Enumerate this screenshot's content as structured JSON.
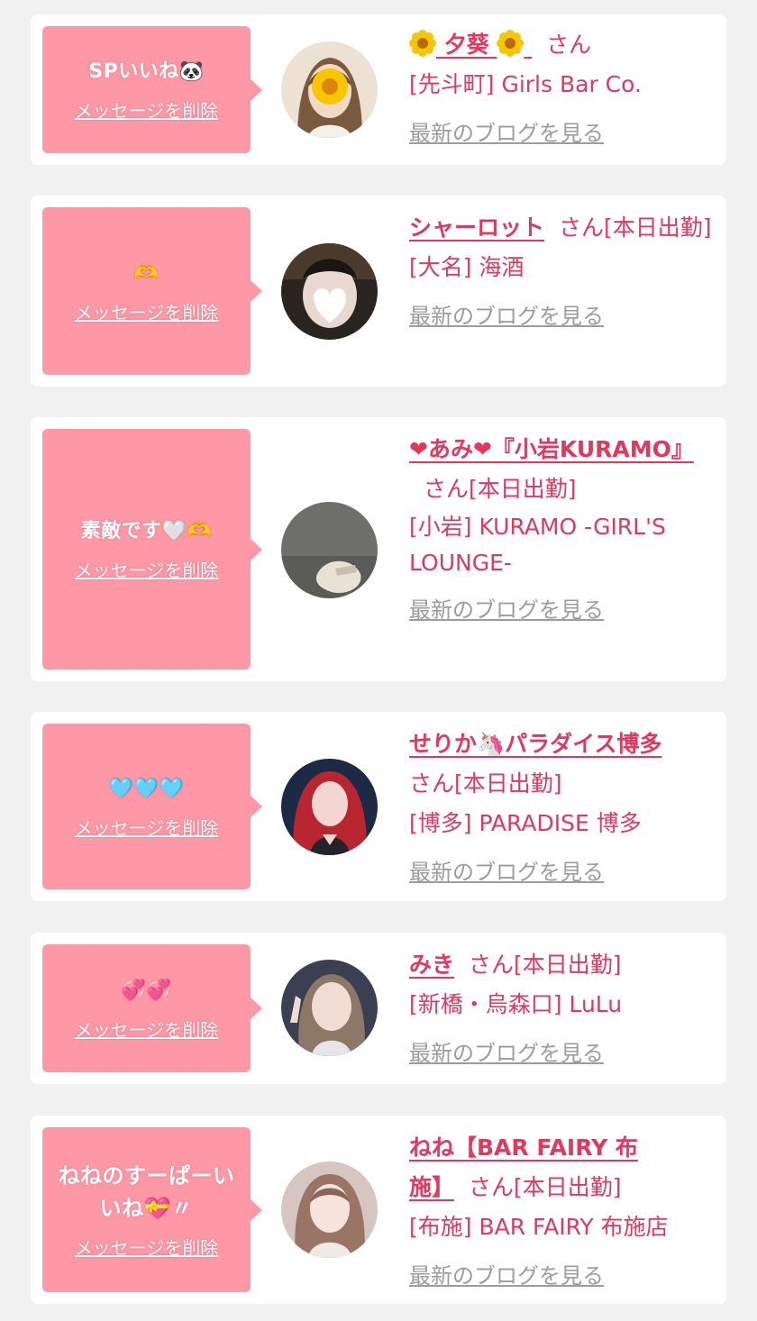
{
  "cards": [
    {
      "message": "SPいいね🐼",
      "delete_label": "メッセージを削除",
      "name": " 夕葵 ",
      "name_icon": "sunflower-icon",
      "san": "さん",
      "status": "",
      "shop": "[先斗町] Girls Bar Co.",
      "blog_label": "最新のブログを見る",
      "avatar_colors": [
        "#e9dccb",
        "#7a5a3e"
      ]
    },
    {
      "message": "🫶",
      "delete_label": "メッセージを削除",
      "name": "シャーロット",
      "san": "さん",
      "status": "[本日出勤]",
      "shop": "[大名] 海酒",
      "blog_label": "最新のブログを見る",
      "avatar_colors": [
        "#2b2520",
        "#5a4434"
      ]
    },
    {
      "message": "素敵です🤍🫶",
      "delete_label": "メッセージを削除",
      "name": "❤あみ❤『小岩KURAMO』",
      "san": "さん",
      "status": "[本日出勤]",
      "shop": "[小岩] KURAMO -GIRL'S LOUNGE-",
      "blog_label": "最新のブログを見る",
      "avatar_colors": [
        "#6d6d6a",
        "#a8a49a"
      ]
    },
    {
      "message": "🩵🩵🩵",
      "delete_label": "メッセージを削除",
      "name": "せりか🦄パラダイス博多",
      "san": "さん",
      "status": "[本日出勤]",
      "shop": "[博多] PARADISE 博多",
      "blog_label": "最新のブログを見る",
      "avatar_colors": [
        "#1f2d4a",
        "#c0303d"
      ]
    },
    {
      "message": "💞💞",
      "delete_label": "メッセージを削除",
      "name": "みき",
      "san": "さん",
      "status": "[本日出勤]",
      "shop": "[新橋・烏森口] LuLu",
      "blog_label": "最新のブログを見る",
      "avatar_colors": [
        "#3a3f52",
        "#d9c2b8"
      ]
    },
    {
      "message": "ねねのすーぱーいいね💝〃",
      "delete_label": "メッセージを削除",
      "name": "ねね【BAR FAIRY 布施】",
      "san": "さん",
      "status": "[本日出勤]",
      "shop": "[布施] BAR FAIRY 布施店",
      "blog_label": "最新のブログを見る",
      "avatar_colors": [
        "#d8c7c2",
        "#8a6a5c"
      ]
    }
  ]
}
